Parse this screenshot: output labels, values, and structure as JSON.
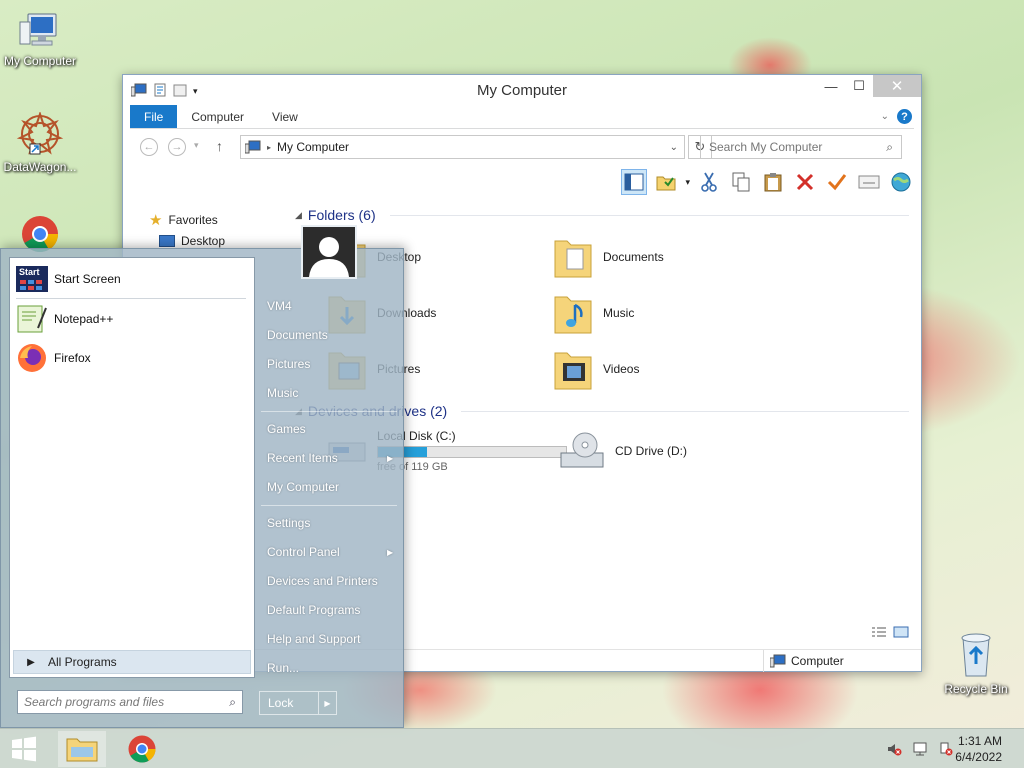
{
  "desktop": {
    "icons": [
      {
        "label": "My Computer"
      },
      {
        "label": "DataWagon..."
      },
      {
        "label": "Recycle Bin"
      }
    ]
  },
  "window": {
    "title": "My Computer",
    "tabs": [
      {
        "label": "File"
      },
      {
        "label": "Computer"
      },
      {
        "label": "View"
      }
    ],
    "address": "My Computer",
    "search_placeholder": "Search My Computer",
    "nav": {
      "favorites": "Favorites",
      "desktop": "Desktop"
    },
    "folders_header": "Folders (6)",
    "folders": [
      {
        "name": "Desktop"
      },
      {
        "name": "Documents"
      },
      {
        "name": "Downloads"
      },
      {
        "name": "Music"
      },
      {
        "name": "Pictures"
      },
      {
        "name": "Videos"
      }
    ],
    "drives_header": "Devices and drives (2)",
    "drives": [
      {
        "name": "Local Disk (C:)",
        "space": "free of 119 GB",
        "used_fraction": 0.26
      },
      {
        "name": "CD Drive (D:)"
      }
    ],
    "status_location": "Computer"
  },
  "start_menu": {
    "programs": [
      {
        "label": "Start Screen"
      },
      {
        "label": "Notepad++"
      },
      {
        "label": "Firefox"
      }
    ],
    "all_programs": "All Programs",
    "search_placeholder": "Search programs and files",
    "right_items": [
      {
        "label": "VM4"
      },
      {
        "label": "Documents"
      },
      {
        "label": "Pictures"
      },
      {
        "label": "Music"
      },
      {
        "label": "Games"
      },
      {
        "label": "Recent Items"
      },
      {
        "label": "My Computer"
      },
      {
        "label": "Settings"
      },
      {
        "label": "Control Panel"
      },
      {
        "label": "Devices and Printers"
      },
      {
        "label": "Default Programs"
      },
      {
        "label": "Help and Support"
      },
      {
        "label": "Run..."
      }
    ],
    "lock_label": "Lock",
    "start_tile_text": "Start"
  },
  "taskbar": {
    "time": "1:31 AM",
    "date": "6/4/2022"
  },
  "colors": {
    "accent": "#1979ca",
    "progress": "#26a0da"
  }
}
